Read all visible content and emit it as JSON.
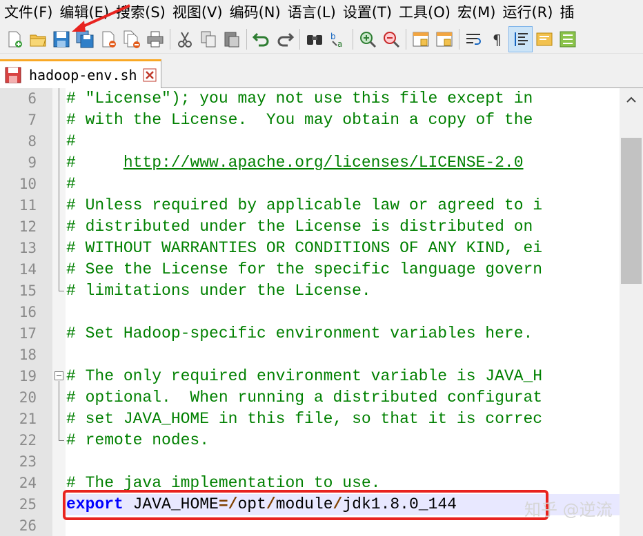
{
  "menubar": {
    "items": [
      "文件(F)",
      "编辑(E)",
      "搜索(S)",
      "视图(V)",
      "编码(N)",
      "语言(L)",
      "设置(T)",
      "工具(O)",
      "宏(M)",
      "运行(R)",
      "插"
    ]
  },
  "toolbar": {
    "buttons": [
      "new-file-icon",
      "open-folder-icon",
      "save-icon",
      "save-all-icon",
      "close-icon",
      "close-all-icon",
      "print-icon",
      "cut-icon",
      "copy-icon",
      "paste-icon",
      "undo-icon",
      "redo-icon",
      "find-icon",
      "replace-icon",
      "zoom-in-icon",
      "zoom-out-icon",
      "sync-v-icon",
      "sync-h-icon",
      "wrap-icon",
      "show-all-chars-icon",
      "indent-guide-icon",
      "doc-map-icon",
      "function-list-icon"
    ]
  },
  "tab": {
    "label": "hadoop-env.sh"
  },
  "editor": {
    "lines": [
      {
        "num": "6",
        "text": "# \"License\"); you may not use this file except in"
      },
      {
        "num": "7",
        "text": "# with the License.  You may obtain a copy of the"
      },
      {
        "num": "8",
        "text": "#"
      },
      {
        "num": "9",
        "prefix": "#     ",
        "link": "http://www.apache.org/licenses/LICENSE-2.0"
      },
      {
        "num": "10",
        "text": "#"
      },
      {
        "num": "11",
        "text": "# Unless required by applicable law or agreed to i"
      },
      {
        "num": "12",
        "text": "# distributed under the License is distributed on"
      },
      {
        "num": "13",
        "text": "# WITHOUT WARRANTIES OR CONDITIONS OF ANY KIND, ei"
      },
      {
        "num": "14",
        "text": "# See the License for the specific language govern"
      },
      {
        "num": "15",
        "text": "# limitations under the License."
      },
      {
        "num": "16",
        "text": ""
      },
      {
        "num": "17",
        "text": "# Set Hadoop-specific environment variables here."
      },
      {
        "num": "18",
        "text": ""
      },
      {
        "num": "19",
        "text": "# The only required environment variable is JAVA_H"
      },
      {
        "num": "20",
        "text": "# optional.  When running a distributed configurat"
      },
      {
        "num": "21",
        "text": "# set JAVA_HOME in this file, so that it is correc"
      },
      {
        "num": "22",
        "text": "# remote nodes."
      },
      {
        "num": "23",
        "text": ""
      },
      {
        "num": "24",
        "text": "# The java implementation to use."
      },
      {
        "num": "25",
        "keyword": "export",
        "var": " JAVA_HOME",
        "eq": "=",
        "path1": "/",
        "p1": "opt",
        "path2": "/",
        "p2": "module",
        "path3": "/",
        "p3": "jdk1.8.0_144"
      },
      {
        "num": "26",
        "text": ""
      }
    ]
  },
  "watermark": "知乎 @逆流",
  "colors": {
    "comment": "#008000",
    "keyword": "#0000ff",
    "highlight": "#e8231f",
    "tab_accent": "#f9a825"
  }
}
